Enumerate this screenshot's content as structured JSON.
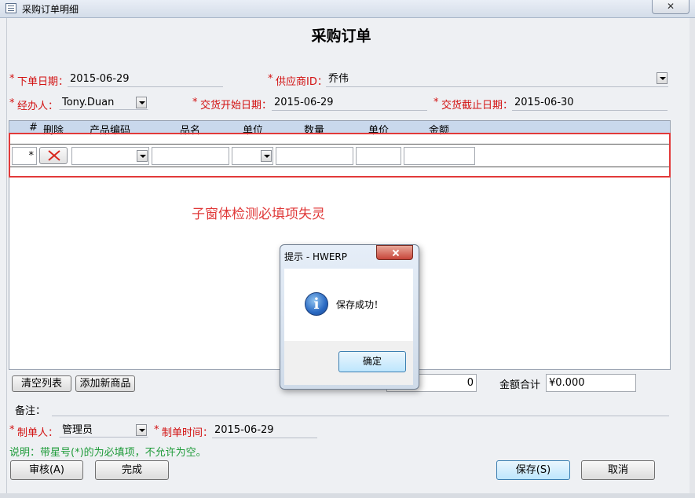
{
  "window": {
    "title": "采购订单明细",
    "close_glyph": "✕"
  },
  "form": {
    "title": "采购订单"
  },
  "header": {
    "order_date": {
      "star": "*",
      "label": "下单日期：",
      "value": "2015-06-29"
    },
    "supplier": {
      "star": "*",
      "label": "供应商ID：",
      "value": "乔伟"
    },
    "handler": {
      "star": "*",
      "label": "经办人：",
      "value": "Tony.Duan"
    },
    "delivery_start": {
      "star": "*",
      "label": "交货开始日期：",
      "value": "2015-06-29"
    },
    "delivery_end": {
      "star": "*",
      "label": "交货截止日期：",
      "value": "2015-06-30"
    }
  },
  "grid": {
    "columns": [
      "#",
      "删除",
      "产品编码",
      "品名",
      "单位",
      "数量",
      "单价",
      "金额"
    ],
    "new_row_marker": "*"
  },
  "annotation": {
    "text": "子窗体检测必填项失灵",
    "color": "#e03a3a"
  },
  "grid_footer": {
    "clear_label": "清空列表",
    "add_label": "添加新商品",
    "quantity_total": "0",
    "amount_total_label": "金额合计",
    "amount_total_value": "¥0.000"
  },
  "remarks": {
    "label": "备注："
  },
  "creator": {
    "star": "*",
    "label": "制单人：",
    "value": "管理员"
  },
  "created_time": {
    "star": "*",
    "label": "制单时间：",
    "value": "2015-06-29"
  },
  "instruction": {
    "text": "说明：带星号(*)的为必填项，不允许为空。",
    "color": "#1f9b3a"
  },
  "buttons": {
    "review": "审核(A)",
    "done": "完成",
    "save": "保存(S)",
    "cancel": "取消"
  },
  "dialog": {
    "title": "提示 - HWERP",
    "message": "保存成功！",
    "icon": "information-icon",
    "icon_glyph": "i",
    "ok_label": "确定"
  },
  "colors": {
    "required_star": "#d21010",
    "highlight_border": "#e23a3a",
    "grid_header": "#c9d8ec"
  }
}
